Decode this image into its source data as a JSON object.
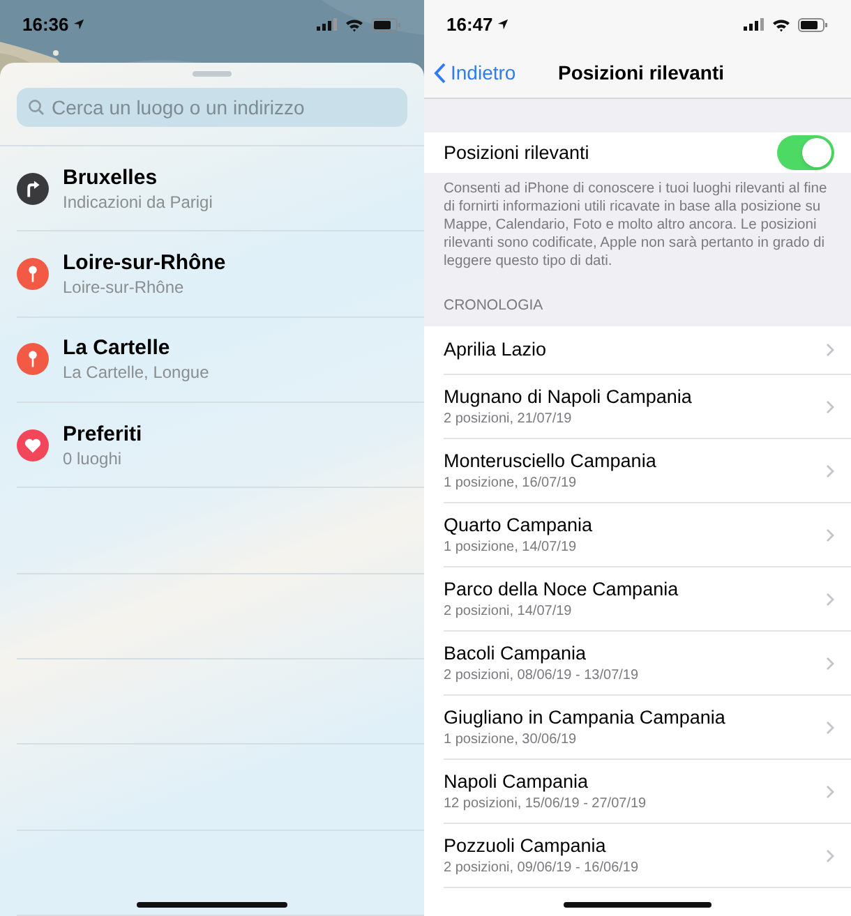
{
  "maps_screen": {
    "status_bar": {
      "time": "16:36"
    },
    "search": {
      "placeholder": "Cerca un luogo o un indirizzo"
    },
    "items": [
      {
        "kind": "directions",
        "title": "Bruxelles",
        "subtitle": "Indicazioni da Parigi"
      },
      {
        "kind": "pin",
        "title": "Loire-sur-Rhône",
        "subtitle": "Loire-sur-Rhône"
      },
      {
        "kind": "pin",
        "title": "La Cartelle",
        "subtitle": "La Cartelle, Longue"
      },
      {
        "kind": "favorites",
        "title": "Preferiti",
        "subtitle": "0 luoghi"
      }
    ]
  },
  "settings_screen": {
    "status_bar": {
      "time": "16:47"
    },
    "nav": {
      "back": "Indietro",
      "title": "Posizioni rilevanti"
    },
    "toggle": {
      "label": "Posizioni rilevanti",
      "on": true
    },
    "description": "Consenti ad iPhone di conoscere i tuoi luoghi rilevanti al fine di fornirti informazioni utili ricavate in base alla posizione su Mappe, Calendario, Foto e molto altro ancora. Le posizioni rilevanti sono codificate, Apple non sarà pertanto in grado di leggere questo tipo di dati.",
    "section_header": "CRONOLOGIA",
    "history": [
      {
        "title": "Aprilia Lazio"
      },
      {
        "title": "Mugnano di Napoli Campania",
        "subtitle": "2 posizioni, 21/07/19"
      },
      {
        "title": "Monterusciello Campania",
        "subtitle": "1 posizione, 16/07/19"
      },
      {
        "title": "Quarto Campania",
        "subtitle": "1 posizione, 14/07/19"
      },
      {
        "title": "Parco della Noce Campania",
        "subtitle": "2 posizioni, 14/07/19"
      },
      {
        "title": "Bacoli Campania",
        "subtitle": "2 posizioni, 08/06/19 - 13/07/19"
      },
      {
        "title": "Giugliano in Campania Campania",
        "subtitle": "1 posizione, 30/06/19"
      },
      {
        "title": "Napoli Campania",
        "subtitle": "12 posizioni, 15/06/19 - 27/07/19"
      },
      {
        "title": "Pozzuoli Campania",
        "subtitle": "2 posizioni, 09/06/19 - 16/06/19"
      }
    ]
  }
}
